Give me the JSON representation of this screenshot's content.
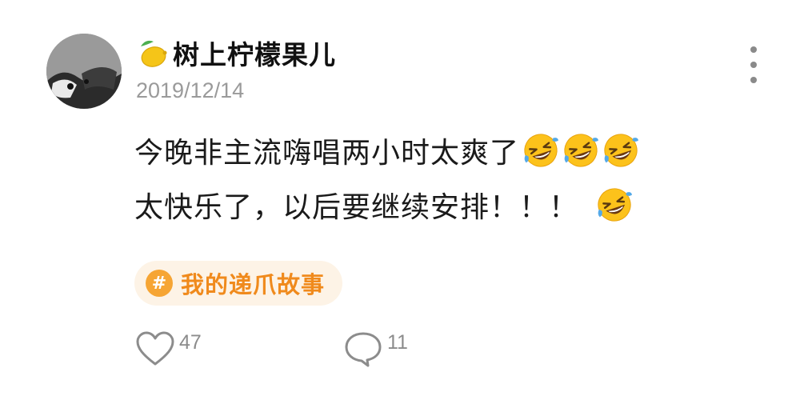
{
  "user": {
    "name": "树上柠檬果儿",
    "badge_icon": "lemon-icon",
    "avatar_icon": "cat-avatar"
  },
  "post": {
    "date": "2019/12/14",
    "line1_text": "今晚非主流嗨唱两小时太爽了",
    "line1_emoji": [
      "rofl-emoji",
      "rofl-emoji",
      "rofl-emoji"
    ],
    "line2_text": "太快乐了，以后要继续安排！！！",
    "line2_emoji": [
      "rofl-emoji"
    ]
  },
  "topic": {
    "icon": "hash-icon",
    "label": "我的递爪故事"
  },
  "actions": {
    "like_count": "47",
    "like_icon": "heart-icon",
    "comment_count": "11",
    "comment_icon": "comment-bubble-icon",
    "more_icon": "more-vertical-icon"
  },
  "colors": {
    "tag_background": "#fdf3e6",
    "tag_accent": "#f08a1c",
    "date_gray": "#9a9a9a"
  }
}
